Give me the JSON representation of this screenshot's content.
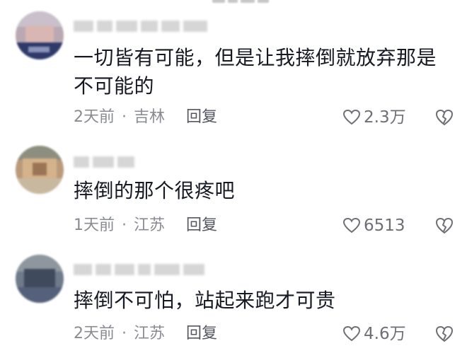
{
  "comments": [
    {
      "text": "一切皆有可能，但是让我摔倒就放弃那是不可能的",
      "time": "2天前",
      "location": "吉林",
      "reply_label": "回复",
      "likes": "2.3万",
      "separator": "·"
    },
    {
      "text": "摔倒的那个很疼吧",
      "time": "1天前",
      "location": "江苏",
      "reply_label": "回复",
      "likes": "6513",
      "separator": "·"
    },
    {
      "text": "摔倒不可怕，站起来跑才可贵",
      "time": "2天前",
      "location": "江苏",
      "reply_label": "回复",
      "likes": "4.6万",
      "separator": "·"
    }
  ],
  "icons": {
    "like": "heart-outline-icon",
    "dislike": "broken-heart-icon"
  },
  "colors": {
    "text": "#161823",
    "meta": "#8a8b91",
    "icon": "#6e6f75"
  }
}
